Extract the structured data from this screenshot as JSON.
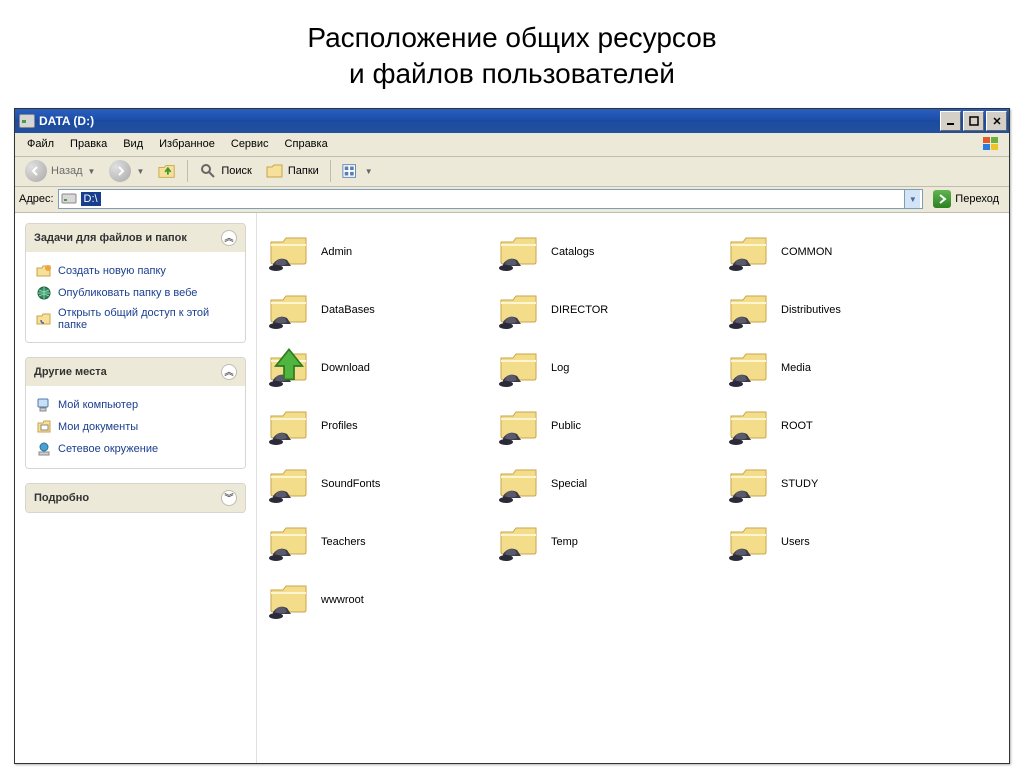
{
  "slide": {
    "title_line1": "Расположение общих ресурсов",
    "title_line2": "и файлов пользователей"
  },
  "window": {
    "title": "DATA (D:)"
  },
  "menu": {
    "file": "Файл",
    "edit": "Правка",
    "view": "Вид",
    "favorites": "Избранное",
    "tools": "Сервис",
    "help": "Справка"
  },
  "toolbar": {
    "back": "Назад",
    "search": "Поиск",
    "folders": "Папки"
  },
  "address": {
    "label": "Адрес:",
    "value": "D:\\",
    "go": "Переход"
  },
  "tasks": {
    "files_header": "Задачи для файлов и папок",
    "new_folder": "Создать новую папку",
    "publish_web": "Опубликовать папку в вебе",
    "share_folder": "Открыть общий доступ к этой папке",
    "places_header": "Другие места",
    "my_computer": "Мой компьютер",
    "my_documents": "Мои документы",
    "network_places": "Сетевое окружение",
    "details_header": "Подробно"
  },
  "folders": [
    {
      "name": "Admin"
    },
    {
      "name": "Catalogs"
    },
    {
      "name": "COMMON"
    },
    {
      "name": "DataBases"
    },
    {
      "name": "DIRECTOR"
    },
    {
      "name": "Distributives"
    },
    {
      "name": "Download",
      "special": "download"
    },
    {
      "name": "Log"
    },
    {
      "name": "Media"
    },
    {
      "name": "Profiles"
    },
    {
      "name": "Public"
    },
    {
      "name": "ROOT"
    },
    {
      "name": "SoundFonts"
    },
    {
      "name": "Special"
    },
    {
      "name": "STUDY"
    },
    {
      "name": "Teachers"
    },
    {
      "name": "Temp"
    },
    {
      "name": "Users"
    },
    {
      "name": "wwwroot"
    }
  ]
}
